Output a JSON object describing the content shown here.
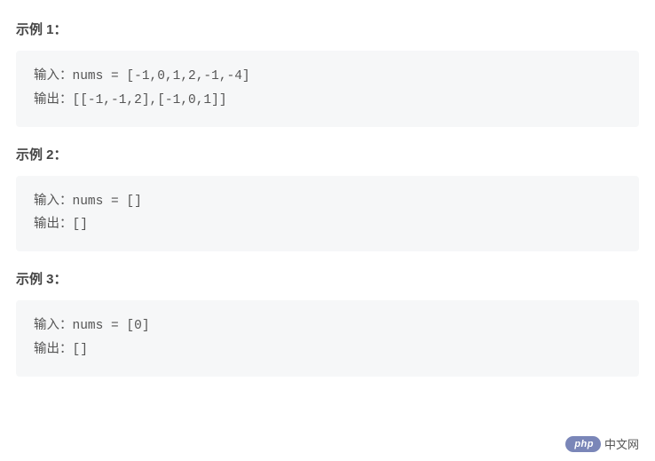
{
  "examples": [
    {
      "heading": "示例 1：",
      "input_label": "输入：",
      "input_value": "nums = [-1,0,1,2,-1,-4]",
      "output_label": "输出：",
      "output_value": "[[-1,-1,2],[-1,0,1]]"
    },
    {
      "heading": "示例 2：",
      "input_label": "输入：",
      "input_value": "nums = []",
      "output_label": "输出：",
      "output_value": "[]"
    },
    {
      "heading": "示例 3：",
      "input_label": "输入：",
      "input_value": "nums = [0]",
      "output_label": "输出：",
      "output_value": "[]"
    }
  ],
  "watermark": {
    "badge": "php",
    "text": "中文网"
  }
}
